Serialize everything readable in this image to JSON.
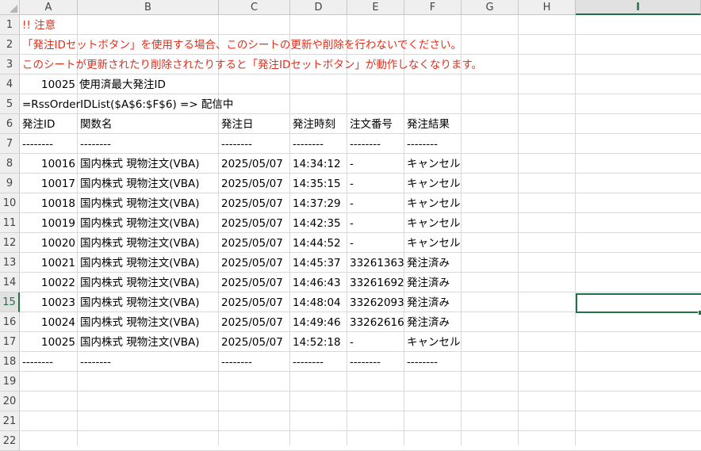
{
  "columns": [
    "A",
    "B",
    "C",
    "D",
    "E",
    "F",
    "G",
    "H",
    "I"
  ],
  "rows": [
    "1",
    "2",
    "3",
    "4",
    "5",
    "6",
    "7",
    "8",
    "9",
    "10",
    "11",
    "12",
    "13",
    "14",
    "15",
    "16",
    "17",
    "18",
    "19",
    "20",
    "21",
    "22"
  ],
  "selected_cell": {
    "column": "I",
    "row": "15"
  },
  "notes": {
    "line1": "!! 注意",
    "line2": "「発注IDセットボタン」を使用する場合、このシートの更新や削除を行わないでください。",
    "line3": "このシートが更新されたり削除されたりすると「発注IDセットボタン」が動作しなくなります。",
    "color": "#e0301e"
  },
  "max_order": {
    "value": "10025",
    "label": "使用済最大発注ID"
  },
  "formula_note": "=RssOrderIDList($A$6:$F$6) => 配信中",
  "table": {
    "headers": [
      "発注ID",
      "関数名",
      "発注日",
      "発注時刻",
      "注文番号",
      "発注結果"
    ],
    "separator": "--------",
    "rows": [
      [
        "10016",
        "国内株式 現物注文(VBA)",
        "2025/05/07",
        "14:34:12",
        "-",
        "キャンセル"
      ],
      [
        "10017",
        "国内株式 現物注文(VBA)",
        "2025/05/07",
        "14:35:15",
        "-",
        "キャンセル"
      ],
      [
        "10018",
        "国内株式 現物注文(VBA)",
        "2025/05/07",
        "14:37:29",
        "-",
        "キャンセル"
      ],
      [
        "10019",
        "国内株式 現物注文(VBA)",
        "2025/05/07",
        "14:42:35",
        "-",
        "キャンセル"
      ],
      [
        "10020",
        "国内株式 現物注文(VBA)",
        "2025/05/07",
        "14:44:52",
        "-",
        "キャンセル"
      ],
      [
        "10021",
        "国内株式 現物注文(VBA)",
        "2025/05/07",
        "14:45:37",
        "33261363",
        "発注済み"
      ],
      [
        "10022",
        "国内株式 現物注文(VBA)",
        "2025/05/07",
        "14:46:43",
        "33261692",
        "発注済み"
      ],
      [
        "10023",
        "国内株式 現物注文(VBA)",
        "2025/05/07",
        "14:48:04",
        "33262093",
        "発注済み"
      ],
      [
        "10024",
        "国内株式 現物注文(VBA)",
        "2025/05/07",
        "14:49:46",
        "33262616",
        "発注済み"
      ],
      [
        "10025",
        "国内株式 現物注文(VBA)",
        "2025/05/07",
        "14:52:18",
        "-",
        "キャンセル"
      ]
    ]
  }
}
